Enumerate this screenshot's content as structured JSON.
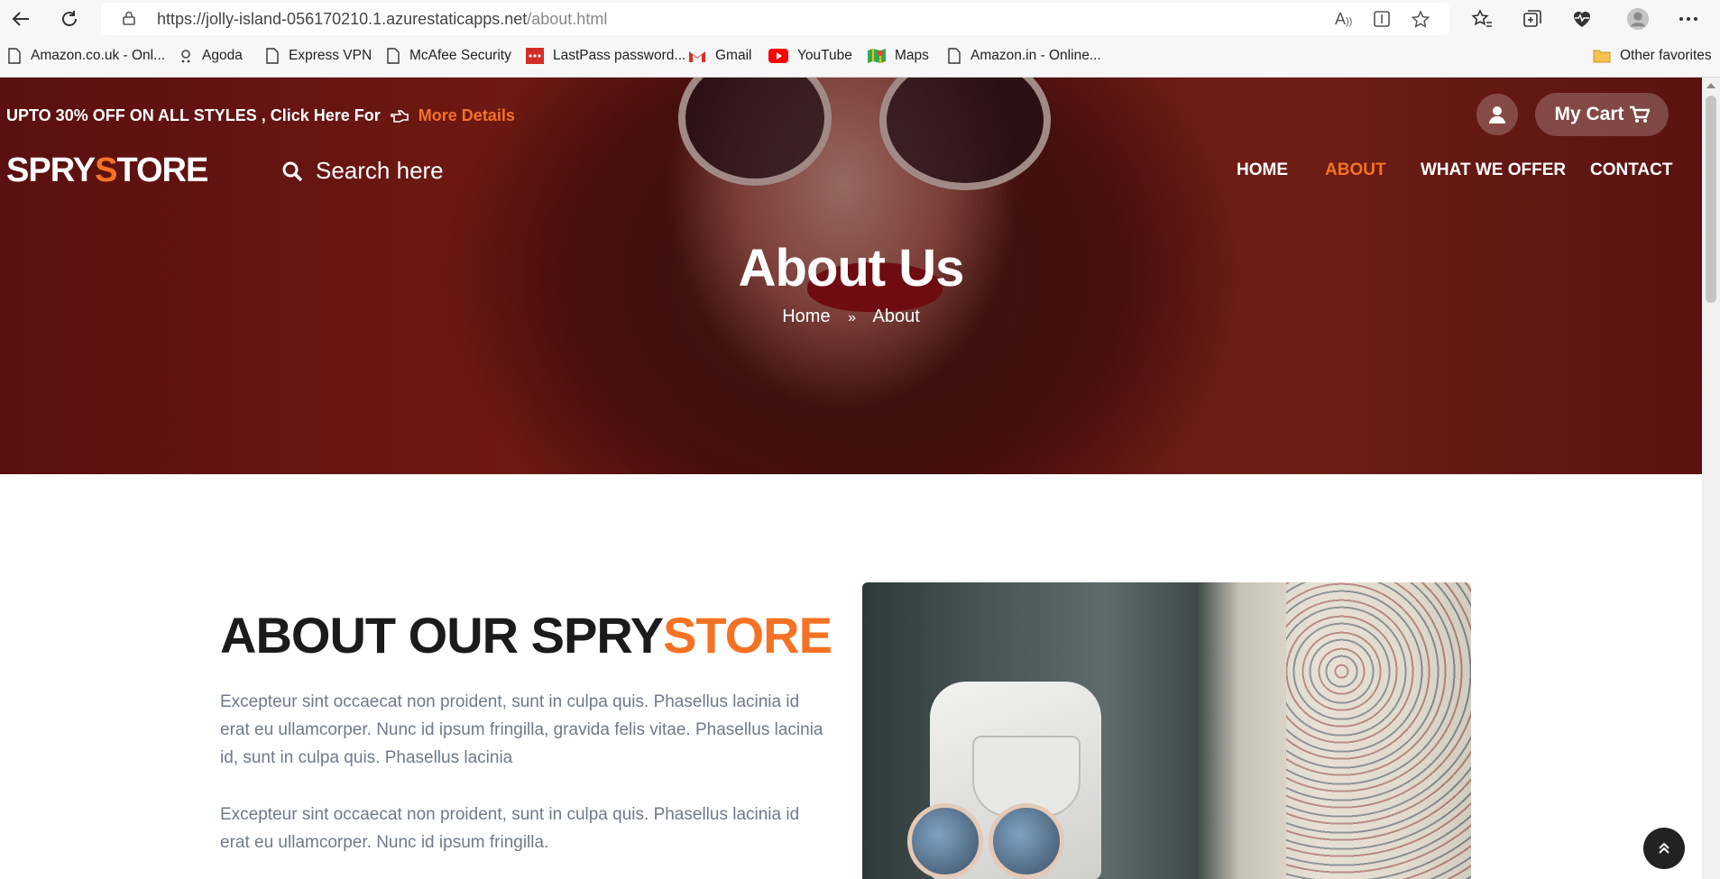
{
  "browser": {
    "url_host": "https://jolly-island-056170210.1.azurestaticapps.net",
    "url_path": "/about.html"
  },
  "bookmarks": [
    {
      "label": "Amazon.co.uk - Onl...",
      "icon": "page-icon"
    },
    {
      "label": "Agoda",
      "icon": "agoda-icon"
    },
    {
      "label": "Express VPN",
      "icon": "page-icon"
    },
    {
      "label": "McAfee Security",
      "icon": "page-icon"
    },
    {
      "label": "LastPass password...",
      "icon": "lastpass-icon"
    },
    {
      "label": "Gmail",
      "icon": "gmail-icon"
    },
    {
      "label": "YouTube",
      "icon": "youtube-icon"
    },
    {
      "label": "Maps",
      "icon": "maps-icon"
    },
    {
      "label": "Amazon.in - Online...",
      "icon": "page-icon"
    }
  ],
  "other_favorites": "Other favorites",
  "site": {
    "promo_text": "UPTO 30% OFF ON ALL STYLES ,  Click Here For",
    "promo_link": "More Details",
    "cart_label": "My Cart",
    "logo_part1": "SPRY",
    "logo_accent": "S",
    "logo_part2": "TORE",
    "search_placeholder": "Search here",
    "nav": [
      "HOME",
      "ABOUT",
      "WHAT WE OFFER",
      "CONTACT"
    ],
    "active_nav": "ABOUT",
    "hero_title": "About Us",
    "breadcrumb": [
      "Home",
      "About"
    ]
  },
  "about": {
    "heading_main": "ABOUT OUR SPRY",
    "heading_accent": "STORE",
    "paragraphs": [
      "Excepteur sint occaecat non proident, sunt in culpa quis. Phasellus lacinia id erat eu ullamcorper. Nunc id ipsum fringilla, gravida felis vitae. Phasellus lacinia id, sunt in culpa quis. Phasellus lacinia",
      "Excepteur sint occaecat non proident, sunt in culpa quis. Phasellus lacinia id erat eu ullamcorper. Nunc id ipsum fringilla."
    ]
  },
  "colors": {
    "accent": "#f57224",
    "heading": "#1b1b1b",
    "body_text": "#6e7a8a",
    "hero_red": "#8b2219"
  }
}
